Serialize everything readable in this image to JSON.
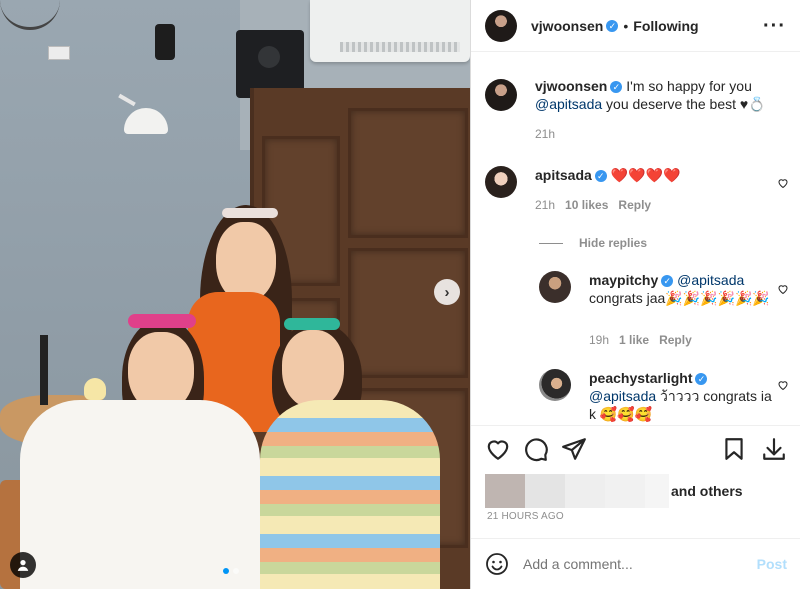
{
  "post": {
    "author": "vjwoonsen",
    "follow_status": "Following",
    "separator": "•",
    "more_icon": "more-horizontal-icon",
    "carousel": {
      "current": 1,
      "total": 2
    }
  },
  "caption": {
    "user": "vjwoonsen",
    "text_before": "I'm so happy for you",
    "mention": "@apitsada",
    "text_after": "you deserve the best ♥💍",
    "time": "21h"
  },
  "comments": [
    {
      "user": "apitsada",
      "text": "❤️❤️❤️❤️",
      "time": "21h",
      "likes": "10 likes",
      "reply": "Reply"
    }
  ],
  "hide_replies": "Hide replies",
  "replies": [
    {
      "user": "maypitchy",
      "mention": "@apitsada",
      "text": "congrats jaa🎉🎉🎉🎉🎉🎉",
      "time": "19h",
      "likes": "1 like",
      "reply": "Reply"
    },
    {
      "user": "peachystarlight",
      "mention": "@apitsada",
      "text": "ว้าววว congrats ia k 🥰🥰🥰"
    }
  ],
  "likes_text": "and others",
  "timestamp": "21 HOURS AGO",
  "comment_box": {
    "placeholder": "Add a comment...",
    "post_label": "Post"
  },
  "colors": {
    "verified": "#3897f0",
    "link": "#00376b",
    "post_disabled": "#b2dffc",
    "carousel_active": "#0095f6"
  }
}
